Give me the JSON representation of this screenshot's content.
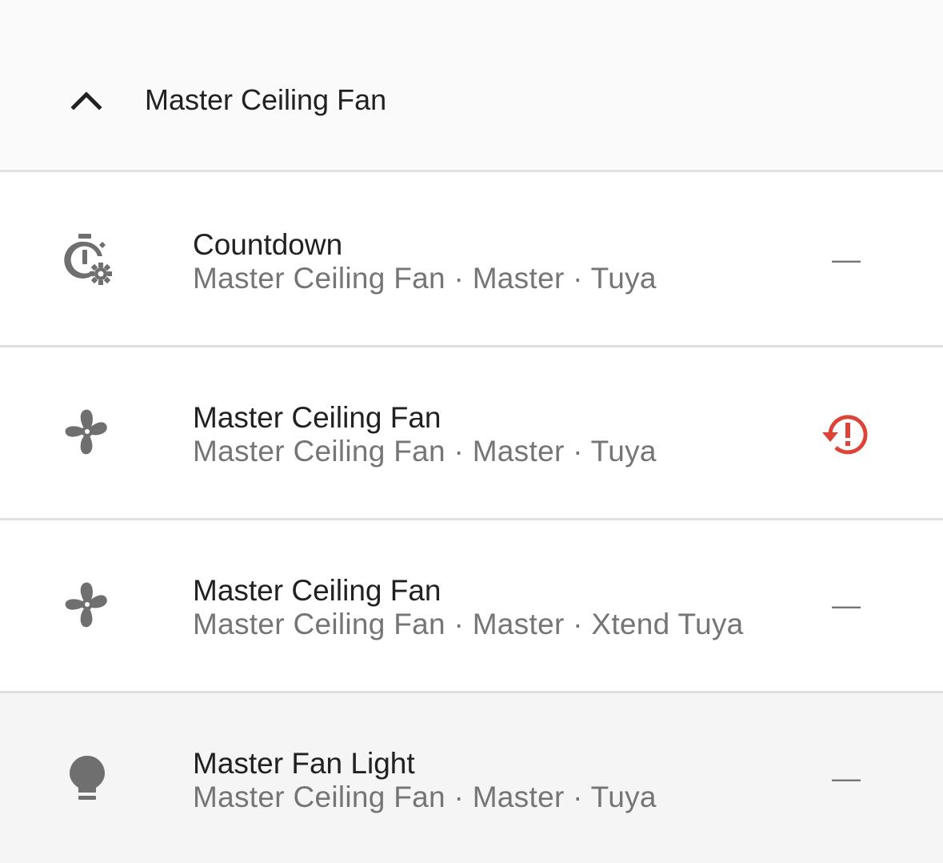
{
  "group": {
    "title": "Master Ceiling Fan",
    "icon": "chevron-up-icon"
  },
  "rows": [
    {
      "name": "Countdown",
      "sub": "Master Ceiling Fan · Master · Tuya",
      "icon": "timer-cog-icon",
      "status": "—"
    },
    {
      "name": "Master Ceiling Fan",
      "sub": "Master Ceiling Fan · Master · Tuya",
      "icon": "fan-icon",
      "status_icon": "restore-alert-icon",
      "status_color": "#db4437"
    },
    {
      "name": "Master Ceiling Fan",
      "sub": "Master Ceiling Fan · Master · Xtend Tuya",
      "icon": "fan-icon",
      "status": "—"
    },
    {
      "name": "Master Fan Light",
      "sub": "Master Ceiling Fan · Master · Tuya",
      "icon": "lightbulb-icon",
      "status": "—"
    }
  ],
  "colors": {
    "icon": "#6f6f6f",
    "primary_text": "#212121",
    "secondary_text": "#757575",
    "error": "#db4437",
    "divider": "#e0e0e0"
  }
}
